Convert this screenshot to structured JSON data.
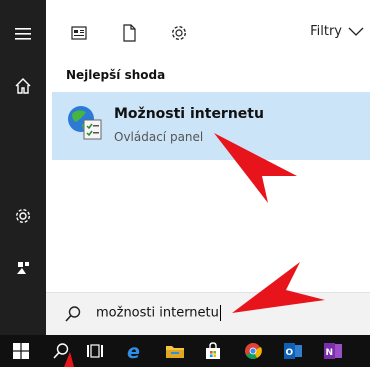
{
  "topbar": {
    "filters_label": "Filtry",
    "icons": [
      "documents-icon",
      "file-icon",
      "settings-icon"
    ]
  },
  "results": {
    "section_title": "Nejlepší shoda",
    "best_match": {
      "title": "Možnosti internetu",
      "subtitle": "Ovládací panel",
      "icon": "internet-options-icon"
    }
  },
  "search": {
    "query": "možnosti internetu",
    "icon": "search-icon"
  },
  "rail": {
    "items": [
      "hamburger-menu-icon",
      "home-icon",
      "settings-icon",
      "user-icon"
    ]
  },
  "taskbar": {
    "items": [
      "windows-start-icon",
      "search-icon",
      "task-view-icon",
      "edge-icon",
      "file-explorer-icon",
      "store-icon",
      "chrome-icon",
      "outlook-icon",
      "onenote-icon"
    ]
  },
  "colors": {
    "selection": "#cce4f7",
    "rail": "#1f1f1f",
    "taskbar": "#101010",
    "arrow": "#e8141c"
  }
}
